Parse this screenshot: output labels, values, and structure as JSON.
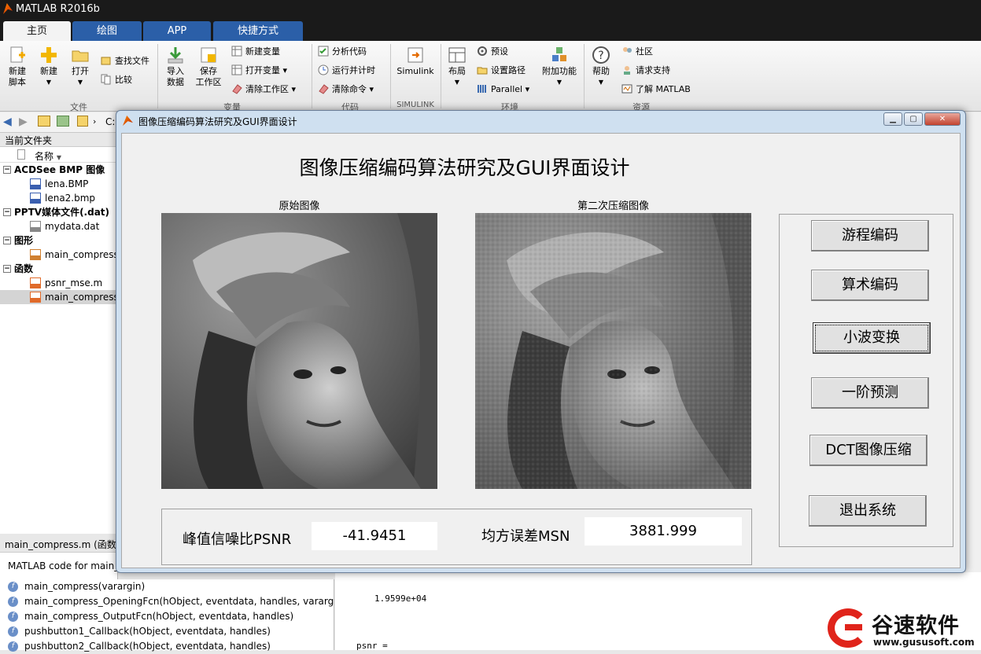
{
  "window": {
    "title": "MATLAB R2016b"
  },
  "tabs": [
    {
      "label": "主页",
      "active": true
    },
    {
      "label": "绘图",
      "active": false
    },
    {
      "label": "APP",
      "active": false
    },
    {
      "label": "快捷方式",
      "active": false
    }
  ],
  "ribbon": {
    "file": {
      "new_script": "新建\n脚本",
      "new": "新建",
      "open": "打开",
      "find_files": "查找文件",
      "compare": "比较",
      "group": "文件"
    },
    "variable": {
      "import_data": "导入\n数据",
      "save_workspace": "保存\n工作区",
      "new_variable": "新建变量",
      "open_variable": "打开变量",
      "clear_workspace": "清除工作区",
      "group": "变量"
    },
    "code": {
      "analyze_code": "分析代码",
      "run_and_time": "运行并计时",
      "clear_commands": "清除命令",
      "group": "代码"
    },
    "simulink": {
      "label": "Simulink",
      "group": "SIMULINK"
    },
    "environment": {
      "layout": "布局",
      "preferences": "预设",
      "set_path": "设置路径",
      "parallel": "Parallel",
      "addons": "附加功能",
      "group": "环境"
    },
    "resources": {
      "help": "帮助",
      "community": "社区",
      "request_support": "请求支持",
      "learn_matlab": "了解 MATLAB",
      "group": "资源"
    }
  },
  "path": {
    "drive": "C:"
  },
  "current_folder": {
    "header": "当前文件夹",
    "column": "名称",
    "tree": [
      {
        "type": "group",
        "label": "ACDSee BMP 图像"
      },
      {
        "type": "item",
        "label": "lena.BMP",
        "icon": "bmp-file-icon"
      },
      {
        "type": "item",
        "label": "lena2.bmp",
        "icon": "bmp-file-icon"
      },
      {
        "type": "group",
        "label": "PPTV媒体文件(.dat)"
      },
      {
        "type": "item",
        "label": "mydata.dat",
        "icon": "dat-file-icon"
      },
      {
        "type": "group",
        "label": "图形"
      },
      {
        "type": "item",
        "label": "main_compress",
        "icon": "figure-file-icon"
      },
      {
        "type": "group",
        "label": "函数"
      },
      {
        "type": "item",
        "label": "psnr_mse.m",
        "icon": "m-file-icon"
      },
      {
        "type": "item",
        "label": "main_compress",
        "icon": "m-file-icon",
        "selected": true
      }
    ]
  },
  "details": {
    "title": "main_compress.m  (函数)",
    "desc": "MATLAB code for main_compress.fig"
  },
  "functions": [
    "main_compress(varargin)",
    "main_compress_OpeningFcn(hObject, eventdata, handles, vararg...",
    "main_compress_OutputFcn(hObject, eventdata, handles)",
    "pushbutton1_Callback(hObject, eventdata, handles)",
    "pushbutton2_Callback(hObject, eventdata, handles)"
  ],
  "command_window": {
    "line1": "1.9599e+04",
    "line2": "psnr ="
  },
  "figure": {
    "title": "图像压缩编码算法研究及GUI界面设计",
    "heading": "图像压缩编码算法研究及GUI界面设计",
    "axes_left_title": "原始图像",
    "axes_right_title": "第二次压缩图像",
    "buttons": [
      "游程编码",
      "算术编码",
      "小波变换",
      "一阶预测",
      "DCT图像压缩",
      "退出系统"
    ],
    "psnr_label": "峰值信噪比PSNR",
    "psnr_value": "-41.9451",
    "mse_label": "均方误差MSN",
    "mse_value": "3881.999"
  },
  "brand": {
    "name": "谷速软件",
    "url": "www.gususoft.com"
  },
  "colors": {
    "tab_active": "#f3f3f3",
    "tab_inactive": "#2b5fa8",
    "brand_red": "#e0241b",
    "figure_frame": "#cfe0f0"
  }
}
